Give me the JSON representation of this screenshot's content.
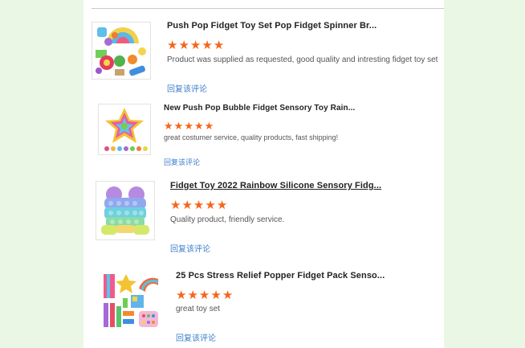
{
  "reviews": [
    {
      "title": "Push Pop Fidget Toy Set Pop Fidget Spinner Br...",
      "rating": 5,
      "star_glyph": "★",
      "comment": "Product was supplied as requested, good quality and intresting fidget toy set",
      "reply_label": "回复该评论",
      "image": "fidget-toy-set-image"
    },
    {
      "title": "New Push Pop Bubble Fidget Sensory Toy Rain...",
      "rating": 5,
      "star_glyph": "★",
      "comment": "great costumer service, quality products, fast shipping!",
      "reply_label": "回复该评论",
      "image": "star-popper-image"
    },
    {
      "title": "Fidget Toy 2022 Rainbow Silicone Sensory Fidg...",
      "rating": 5,
      "star_glyph": "★",
      "comment": "Quality product, friendly service.",
      "reply_label": "回复该评论",
      "image": "frog-popper-image"
    },
    {
      "title": "25 Pcs Stress Relief Popper Fidget Pack Senso...",
      "rating": 5,
      "star_glyph": "★",
      "comment": "great toy set",
      "reply_label": "回复该评论",
      "image": "fidget-pack-image"
    }
  ],
  "colors": {
    "page_background": "#eaf7e4",
    "star": "#f4661b",
    "reply_link": "#3d7ecb"
  }
}
